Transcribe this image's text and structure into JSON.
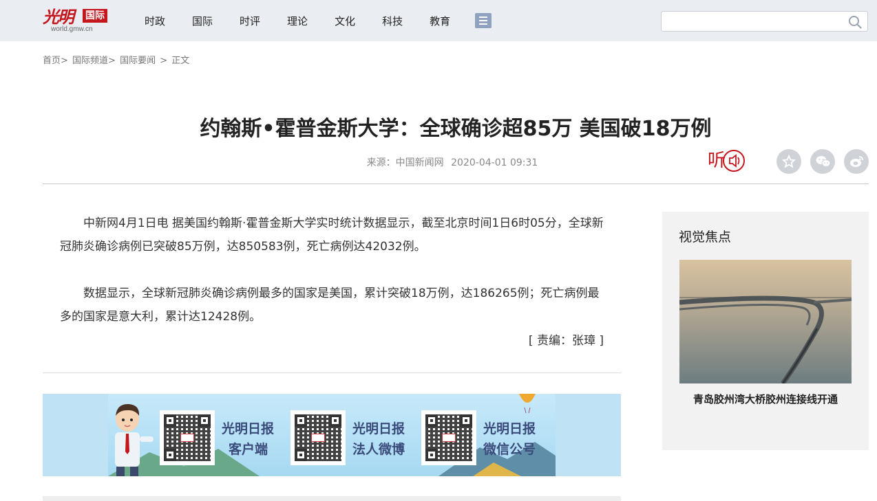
{
  "header": {
    "logo_script": "光明",
    "logo_badge": "国际",
    "logo_url": "world.gmw.cn",
    "nav": [
      "时政",
      "国际",
      "时评",
      "理论",
      "文化",
      "科技",
      "教育"
    ],
    "menu_icon": "list-menu-icon",
    "search_placeholder": "",
    "search_icon": "search-icon"
  },
  "breadcrumb": [
    "首页>",
    "国际频道>",
    "国际要闻",
    ">",
    "正文"
  ],
  "article": {
    "title": "约翰斯•霍普金斯大学：全球确诊超85万 美国破18万例",
    "source": "来源：中国新闻网",
    "datetime": "2020-04-01 09:31",
    "listen_label": "听",
    "paragraphs": [
      "中新网4月1日电 据美国约翰斯·霍普金斯大学实时统计数据显示，截至北京时间1日6时05分，全球新冠肺炎确诊病例已突破85万例，达850583例，死亡病例达42032例。",
      "数据显示，全球新冠肺炎确诊病例最多的国家是美国，累计突破18万例，达186265例；死亡病例最多的国家是意大利，累计达12428例。"
    ],
    "editor": "[ 责编：张璋 ]",
    "share_icons": [
      "star-icon",
      "wechat-icon",
      "weibo-icon"
    ]
  },
  "banner": {
    "items": [
      {
        "line1": "光明日报",
        "line2": "客户端"
      },
      {
        "line1": "光明日报",
        "line2": "法人微博"
      },
      {
        "line1": "光明日报",
        "line2": "微信公号"
      }
    ]
  },
  "sidebar": {
    "title": "视觉焦点",
    "caption": "青岛胶州湾大桥胶州连接线开通"
  },
  "colors": {
    "brand_red": "#c4161c",
    "topbar_bg": "#eaedf1",
    "sidebar_bg": "#f2f2f2"
  }
}
